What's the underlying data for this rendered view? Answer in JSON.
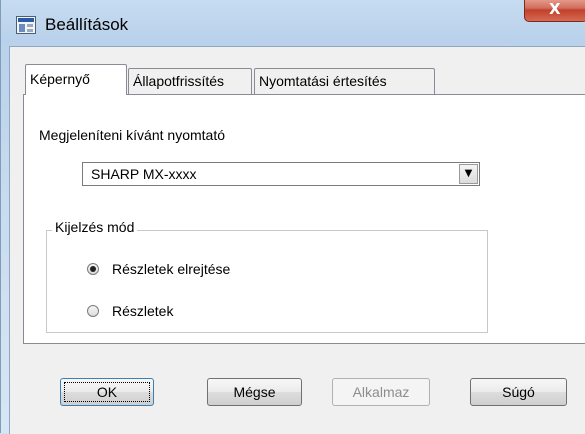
{
  "window": {
    "title": "Beállítások",
    "app_icon": "settings-window-icon",
    "close_glyph": "X",
    "colors": {
      "titlebar": "#b9d1ea",
      "close_button": "#c2402b",
      "client": "#f0f0f0"
    }
  },
  "tabs": [
    {
      "label": "Képernyő",
      "active": true
    },
    {
      "label": "Állapotfrissítés",
      "active": false
    },
    {
      "label": "Nyomtatási értesítés",
      "active": false
    }
  ],
  "display_tab": {
    "printer_label": "Megjeleníteni kívánt nyomtató",
    "printer_selected": "SHARP MX-xxxx",
    "dropdown_glyph": "▼",
    "mode_group": {
      "legend": "Kijelzés mód",
      "options": [
        {
          "label": "Részletek elrejtése",
          "checked": true
        },
        {
          "label": "Részletek",
          "checked": false
        }
      ]
    }
  },
  "buttons": {
    "ok": "OK",
    "cancel": "Mégse",
    "apply": "Alkalmaz",
    "help": "Súgó"
  }
}
